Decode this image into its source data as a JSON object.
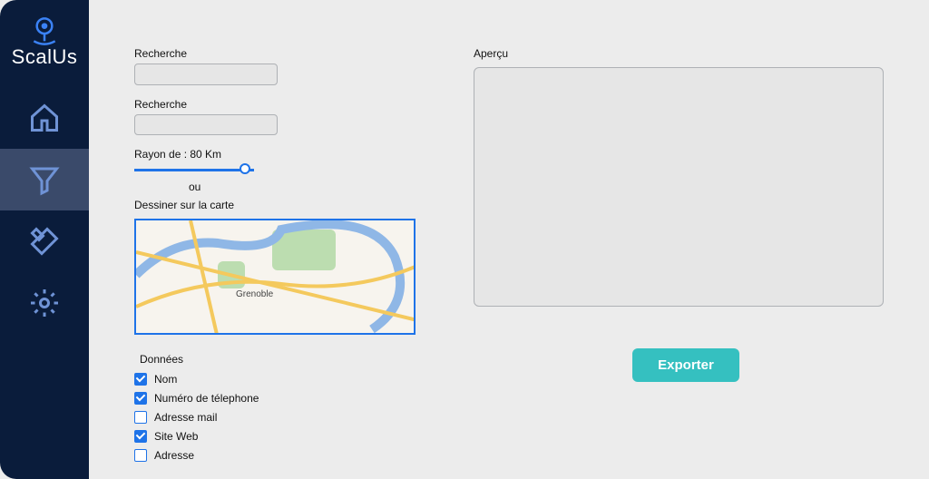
{
  "brand": {
    "name": "ScalUs"
  },
  "sidebar": {
    "items": [
      {
        "name": "home"
      },
      {
        "name": "filter",
        "active": true
      },
      {
        "name": "tools"
      },
      {
        "name": "settings"
      }
    ]
  },
  "form": {
    "search1": {
      "label": "Recherche",
      "value": ""
    },
    "search2": {
      "label": "Recherche",
      "value": ""
    },
    "radius": {
      "label": "Rayon de : 80 Km",
      "value_km": 80
    },
    "or_label": "ou",
    "draw_label": "Dessiner sur la carte",
    "map": {
      "city_label": "Grenoble"
    }
  },
  "data_section": {
    "title": "Données",
    "options": [
      {
        "label": "Nom",
        "checked": true
      },
      {
        "label": "Numéro de télephone",
        "checked": true
      },
      {
        "label": "Adresse mail",
        "checked": false
      },
      {
        "label": "Site Web",
        "checked": true
      },
      {
        "label": "Adresse",
        "checked": false
      }
    ]
  },
  "preview": {
    "label": "Aperçu"
  },
  "actions": {
    "export_label": "Exporter"
  },
  "colors": {
    "sidebar_bg": "#0a1c3b",
    "accent": "#1e73e8",
    "button": "#35c0c0"
  }
}
